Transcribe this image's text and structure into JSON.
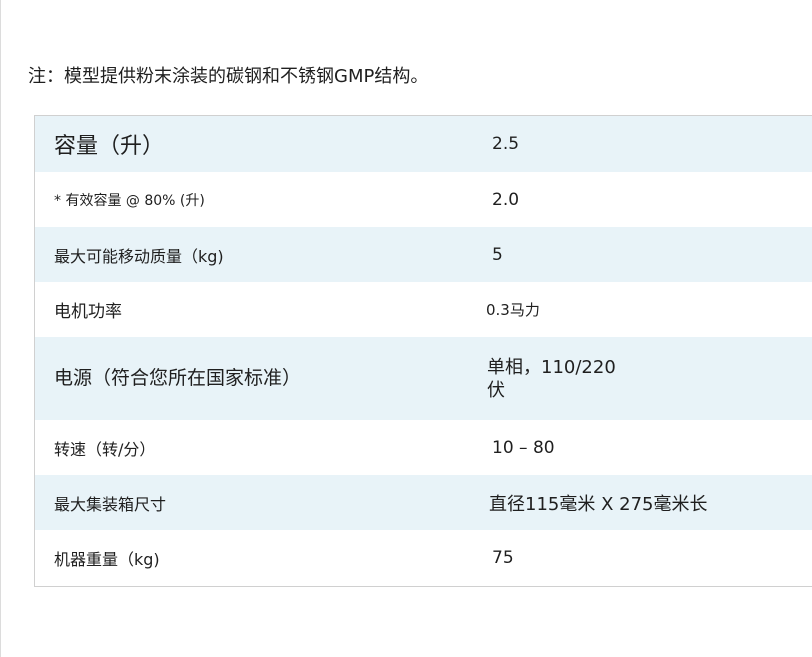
{
  "note": "注：模型提供粉末涂装的碳钢和不锈钢GMP结构。",
  "specs": [
    {
      "label": "容量（升）",
      "value": "2.5"
    },
    {
      "label": "* 有效容量 @ 80% (升)",
      "value": "2.0"
    },
    {
      "label": "最大可能移动质量（kg)",
      "value": "5"
    },
    {
      "label": "电机功率",
      "value": "0.3马力"
    },
    {
      "label": "电源（符合您所在国家标准）",
      "value": "单相，110/220伏"
    },
    {
      "label": "转速（转/分）",
      "value": "10 – 80"
    },
    {
      "label": "最大集装箱尺寸",
      "value": "直径115毫米 X 275毫米长"
    },
    {
      "label": "机器重量（kg)",
      "value": "75"
    }
  ],
  "colors": {
    "row_shade": "#e8f3f8",
    "row_plain": "#ffffff",
    "border": "#d0d0d0"
  }
}
